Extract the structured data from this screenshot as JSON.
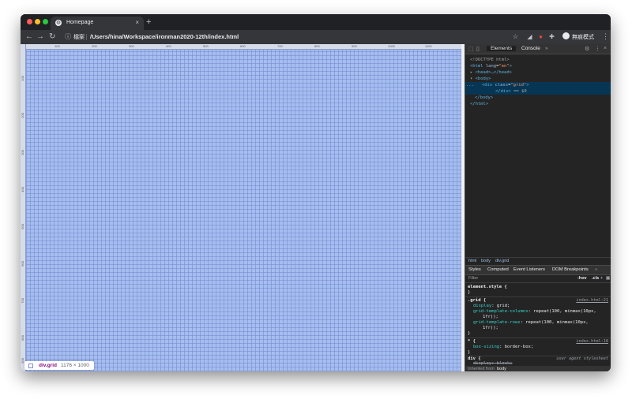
{
  "browser": {
    "tab": {
      "title": "Homepage",
      "close": "×"
    },
    "new_tab": "+",
    "nav": {
      "back": "←",
      "forward": "→",
      "reload": "↻"
    },
    "address": {
      "info": "ⓘ",
      "label": "檔案",
      "url": "/Users/hina/Workspace/ironman2020-12th/index.html"
    },
    "toolbar_icons": [
      "☆",
      "◢",
      "●",
      "✚"
    ],
    "profile_label": "無痕模式",
    "menu": "⋮"
  },
  "page": {
    "ruler_x_ticks": [
      "100",
      "200",
      "300",
      "400",
      "500",
      "600",
      "700",
      "800",
      "900",
      "1000",
      "1100"
    ],
    "ruler_y_ticks": [
      "100",
      "200",
      "300",
      "400",
      "500",
      "600",
      "700",
      "800",
      "900"
    ],
    "tooltip": {
      "tag": "div.grid",
      "dims": "1176 × 1000"
    }
  },
  "devtools": {
    "tabs": {
      "elements": "Elements",
      "console": "Console",
      "more": "»"
    },
    "icons": {
      "inspect": "⬚",
      "device": "▯",
      "settings": "⚙",
      "kebab": "⋮",
      "close": "×"
    },
    "dom": {
      "doctype": "<!DOCTYPE html>",
      "html_open_tag": "<html",
      "lang_attr": "lang",
      "lang_val": "\"en\"",
      "gt": ">",
      "head_arrow": "▸",
      "head": "<head>…</head>",
      "body_arrow": "▾",
      "body_open": "<body>",
      "ellipsis": "...",
      "div_open": "<div",
      "class_attr": "class",
      "class_val": "\"grid\"",
      "div_close": "</div>",
      "dollar": "== $0",
      "body_close": "</body>",
      "html_close": "</html>"
    },
    "breadcrumbs": [
      "html",
      "body",
      "div.grid"
    ],
    "styles_tabs": [
      "Styles",
      "Computed",
      "Event Listeners",
      "DOM Breakpoints",
      "»"
    ],
    "filter": {
      "placeholder": "Filter",
      "hov": ":hov",
      "cls": ".cls",
      "plus": "+",
      "box": "▣"
    },
    "rules": {
      "element_style": "element.style {",
      "close": "}",
      "grid_selector": ".grid {",
      "grid_src": "index.html:21",
      "display_prop": "display",
      "display_val": "grid;",
      "columns_prop": "grid-template-columns",
      "columns_val": "repeat(100, minmax(10px,",
      "columns_cont": "1fr));",
      "rows_prop": "grid-template-rows",
      "rows_val": "repeat(100, minmax(10px,",
      "rows_cont": "1fr));",
      "star_selector": "* {",
      "star_src": "index.html:18",
      "box_prop": "box-sizing",
      "box_val": "border-box;",
      "div_selector": "div {",
      "ua_label": "user agent stylesheet",
      "ua_rule": "display: block;",
      "inherited_label": "Inherited from",
      "inherited_tag": "body"
    }
  }
}
